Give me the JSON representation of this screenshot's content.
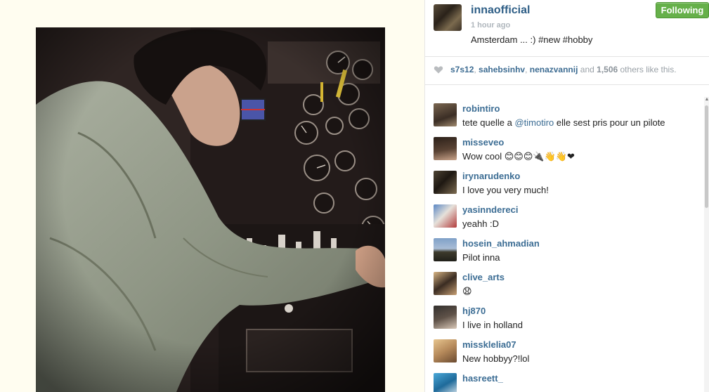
{
  "post": {
    "owner": "innaofficial",
    "time": "1 hour ago",
    "caption": "Amsterdam ... :) #new #hobby",
    "follow_label": "Following"
  },
  "likes": {
    "users": [
      "s7s12",
      "sahebsinhv",
      "nenazvannij"
    ],
    "sep1": ", ",
    "sep2": ", ",
    "and_text": " and ",
    "count": "1,506",
    "tail": " others like this."
  },
  "comments": [
    {
      "user": "robintiro",
      "text_before": "tete quelle a ",
      "mention": "@timotiro",
      "text_after": " elle sest pris pour un pilote"
    },
    {
      "user": "misseveo",
      "text_before": "Wow cool 😊😊😊🔌👋👋❤",
      "mention": "",
      "text_after": ""
    },
    {
      "user": "irynarudenko",
      "text_before": "I love you very much!",
      "mention": "",
      "text_after": ""
    },
    {
      "user": "yasinndereci",
      "text_before": "yeahh :D",
      "mention": "",
      "text_after": ""
    },
    {
      "user": "hosein_ahmadian",
      "text_before": "Pilot inna",
      "mention": "",
      "text_after": ""
    },
    {
      "user": "clive_arts",
      "text_before": "😧",
      "mention": "",
      "text_after": ""
    },
    {
      "user": "hj870",
      "text_before": "I live in holland",
      "mention": "",
      "text_after": ""
    },
    {
      "user": "missklelia07",
      "text_before": "New hobbyy?!lol",
      "mention": "",
      "text_after": ""
    },
    {
      "user": "hasreett_",
      "text_before": "",
      "mention": "",
      "text_after": ""
    }
  ],
  "colors": {
    "username": "#3c6d94",
    "follow_button": "#66b04a",
    "meta_gray": "#b0b7bd"
  }
}
